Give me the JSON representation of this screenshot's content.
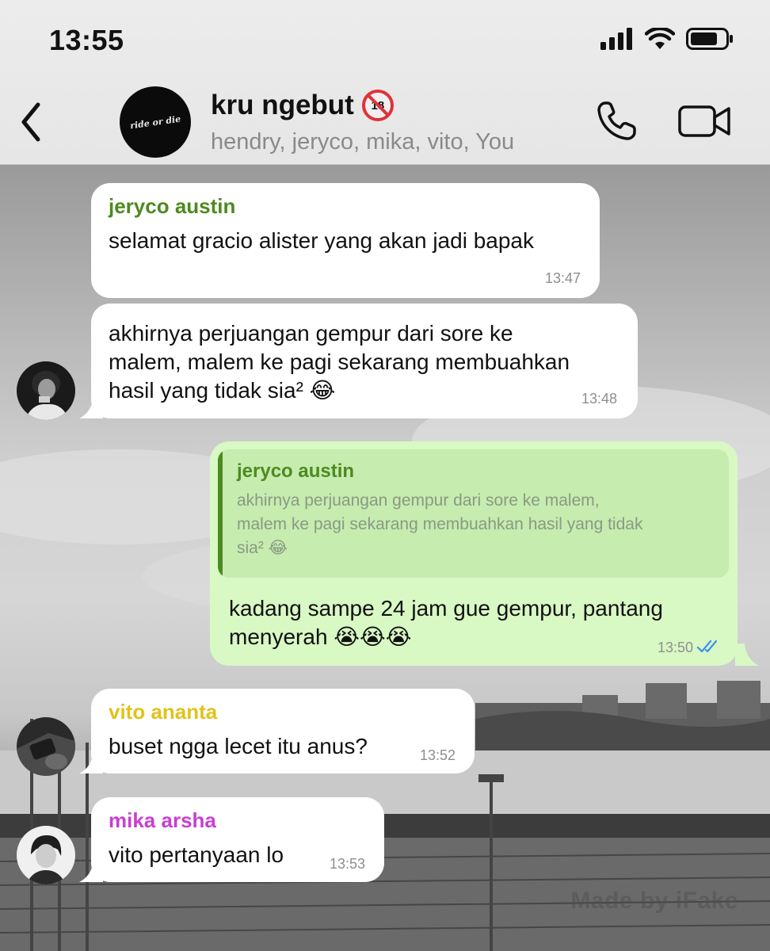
{
  "status_bar": {
    "time": "13:55",
    "icons": [
      "cellular-signal-icon",
      "wifi-icon",
      "battery-icon"
    ]
  },
  "header": {
    "title": "kru ngebut",
    "title_badge": "18",
    "members": "hendry, jeryco, mika, vito, You",
    "avatar_text": "ride or die",
    "back_icon": "chevron-left-icon",
    "call_icon": "phone-icon",
    "video_icon": "video-camera-icon"
  },
  "messages": [
    {
      "direction": "in",
      "sender": "jeryco austin",
      "sender_color": "#4e8a1f",
      "text": "selamat gracio alister yang akan jadi bapak",
      "time": "13:47"
    },
    {
      "direction": "in",
      "text": "akhirnya perjuangan gempur dari sore ke malem, malem ke pagi sekarang membuahkan hasil yang tidak sia² 😂",
      "lines": [
        "akhirnya perjuangan gempur dari sore ke",
        "malem, malem ke pagi sekarang membuahkan",
        "hasil yang tidak sia² 😂"
      ],
      "time": "13:48"
    },
    {
      "direction": "out",
      "quote_sender": "jeryco austin",
      "quote_text": "akhirnya perjuangan gempur dari sore ke malem, malem ke pagi sekarang membuahkan hasil yang tidak sia² 😂",
      "quote_lines": [
        "akhirnya perjuangan gempur dari sore ke malem,",
        "malem ke pagi sekarang membuahkan hasil yang tidak",
        "sia² 😂"
      ],
      "lines": [
        "kadang sampe 24 jam gue gempur, pantang",
        "menyerah 😭😭😭"
      ],
      "time": "13:50",
      "status_icon": "double-check-read-icon"
    },
    {
      "direction": "in",
      "sender": "vito ananta",
      "sender_color": "#e2c21b",
      "text": "buset ngga lecet itu anus?",
      "time": "13:52"
    },
    {
      "direction": "in",
      "sender": "mika arsha",
      "sender_color": "#c93fd0",
      "text": "vito pertanyaan lo",
      "time": "13:53"
    }
  ],
  "watermark": "Made by iFake",
  "colors": {
    "incoming_bubble": "#ffffff",
    "outgoing_bubble": "#d8f8c4",
    "read_check": "#3c8ef0",
    "badge_red": "#e0323b"
  }
}
